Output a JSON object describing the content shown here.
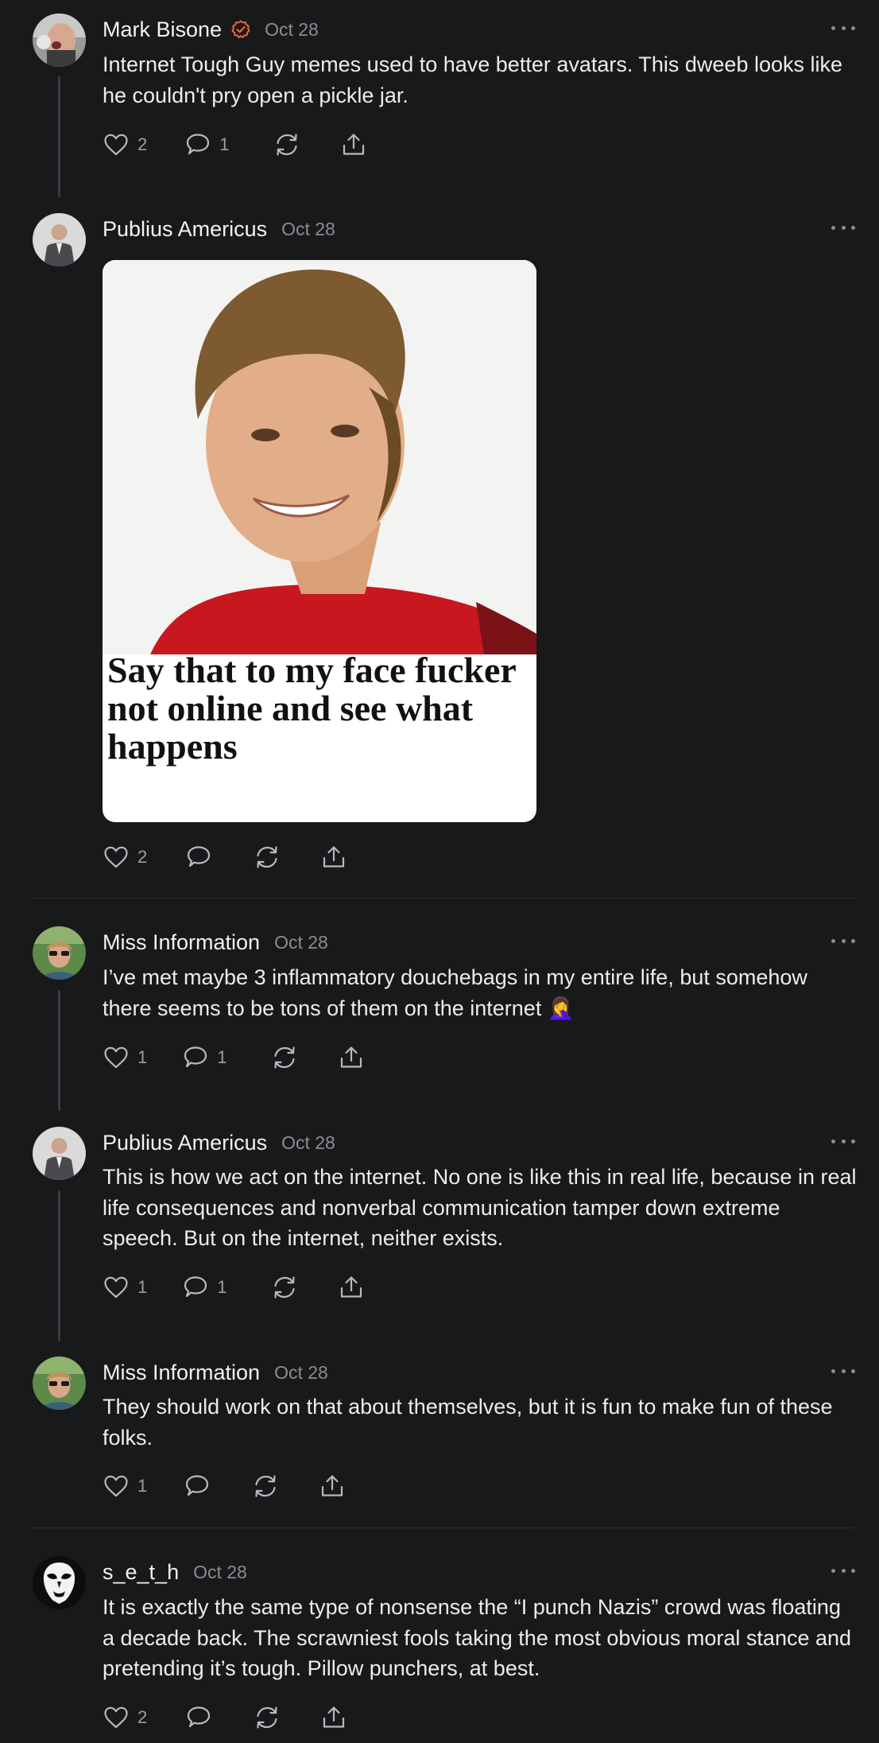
{
  "posts": [
    {
      "author": "Mark Bisone",
      "verified": true,
      "date": "Oct 28",
      "text": "Internet Tough Guy memes used to have better avatars. This dweeb looks like he couldn't pry open a pickle jar.",
      "likes": "2",
      "comments": "1"
    },
    {
      "author": "Publius Americus",
      "date": "Oct 28",
      "image_caption": "Say that to my face fucker not online and see what happens",
      "likes": "2",
      "comments": ""
    },
    {
      "author": "Miss Information",
      "date": "Oct 28",
      "text": "I’ve met maybe 3 inflammatory douchebags in my entire life, but somehow there seems to be tons of them on the internet",
      "emoji": "🤦‍♀️",
      "likes": "1",
      "comments": "1"
    },
    {
      "author": "Publius Americus",
      "date": "Oct 28",
      "text": "This is how we act on the internet. No one is like this in real life, because in real life consequences and nonverbal communication tamper down extreme speech. But on the internet, neither exists.",
      "likes": "1",
      "comments": "1"
    },
    {
      "author": "Miss Information",
      "date": "Oct 28",
      "text": "They should work on that about themselves, but it is fun to make fun of these folks.",
      "likes": "1",
      "comments": ""
    },
    {
      "author": "s_e_t_h",
      "date": "Oct 28",
      "text": "It is exactly the same type of nonsense the “I punch Nazis” crowd was floating a decade back. The scrawniest fools taking the most obvious moral stance and pretending it’s tough. Pillow punchers, at best.",
      "likes": "2",
      "comments": ""
    }
  ],
  "icons": {
    "like": "heart-icon",
    "comment": "comment-bubble-icon",
    "restack": "restack-icon",
    "share": "share-icon",
    "more": "more-dots-icon",
    "verified": "verified-badge-icon"
  },
  "colors": {
    "background": "#18191b",
    "accent_verified": "#f0652f",
    "meta_text": "#8b8c90"
  }
}
